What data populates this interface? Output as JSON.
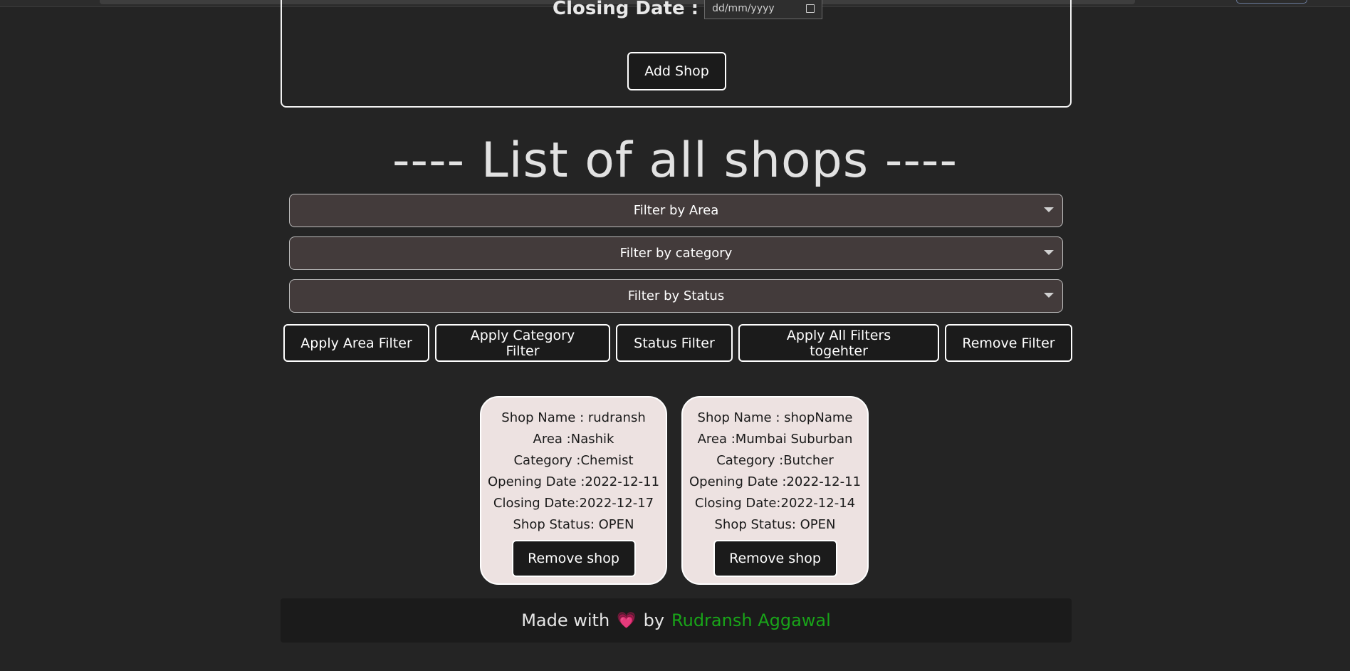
{
  "form": {
    "closing_label": "Closing Date :",
    "closing_value": "dd/mm/yyyy",
    "add_shop_label": "Add Shop"
  },
  "list_title": "---- List of all shops ----",
  "filters": {
    "area_placeholder": "Filter by Area",
    "category_placeholder": "Filter by category",
    "status_placeholder": "Filter by Status"
  },
  "filter_buttons": {
    "area": "Apply Area Filter",
    "category": "Apply Category Filter",
    "status": "Status Filter",
    "all": "Apply All Filters togehter",
    "remove": "Remove Filter"
  },
  "shops": [
    {
      "name": "Shop Name : rudransh",
      "area": "Area :Nashik",
      "category": "Category :Chemist",
      "opening": "Opening Date :2022-12-11",
      "closing": "Closing Date:2022-12-17",
      "status": "Shop Status: OPEN",
      "remove_label": "Remove shop"
    },
    {
      "name": "Shop Name : shopName",
      "area": "Area :Mumbai Suburban",
      "category": "Category :Butcher",
      "opening": "Opening Date :2022-12-11",
      "closing": "Closing Date:2022-12-14",
      "status": "Shop Status: OPEN",
      "remove_label": "Remove shop"
    }
  ],
  "footer": {
    "made_with": "Made with",
    "heart": "💗",
    "by": "by",
    "author": "Rudransh Aggawal"
  },
  "colors": {
    "background": "#242424",
    "card": "#ede2e1",
    "select": "#433b3b",
    "author_green": "#19a419"
  }
}
